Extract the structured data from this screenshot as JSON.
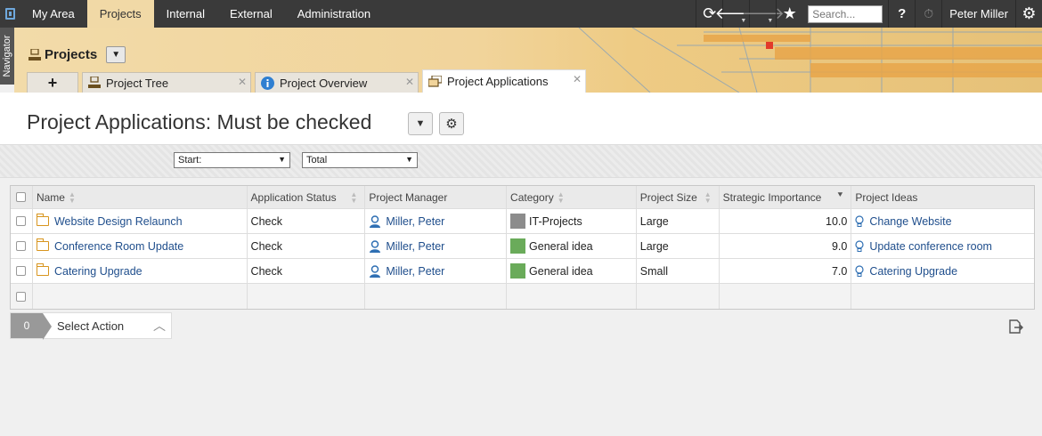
{
  "topnav": {
    "tabs": [
      "My Area",
      "Projects",
      "Internal",
      "External",
      "Administration"
    ],
    "active": 1,
    "search_placeholder": "Search...",
    "user": "Peter Miller"
  },
  "navigator_label": "Navigator",
  "module": {
    "title": "Projects"
  },
  "tabs": [
    {
      "label": "Project Tree"
    },
    {
      "label": "Project Overview"
    },
    {
      "label": "Project Applications"
    }
  ],
  "page_title": "Project Applications: Must be checked",
  "filters": {
    "start": "Start:",
    "total": "Total"
  },
  "grid": {
    "columns": [
      "Name",
      "Application Status",
      "Project Manager",
      "Category",
      "Project Size",
      "Strategic Importance",
      "Project Ideas"
    ],
    "rows": [
      {
        "name": "Website Design Relaunch",
        "status": "Check",
        "manager": "Miller, Peter",
        "category": "IT-Projects",
        "category_color": "#8c8c8c",
        "size": "Large",
        "importance": "10.0",
        "idea": "Change Website"
      },
      {
        "name": "Conference Room Update",
        "status": "Check",
        "manager": "Miller, Peter",
        "category": "General idea",
        "category_color": "#6aab5a",
        "size": "Large",
        "importance": "9.0",
        "idea": "Update conference room"
      },
      {
        "name": "Catering Upgrade",
        "status": "Check",
        "manager": "Miller, Peter",
        "category": "General idea",
        "category_color": "#6aab5a",
        "size": "Small",
        "importance": "7.0",
        "idea": "Catering Upgrade"
      }
    ]
  },
  "action_bar": {
    "count": "0",
    "label": "Select Action"
  }
}
